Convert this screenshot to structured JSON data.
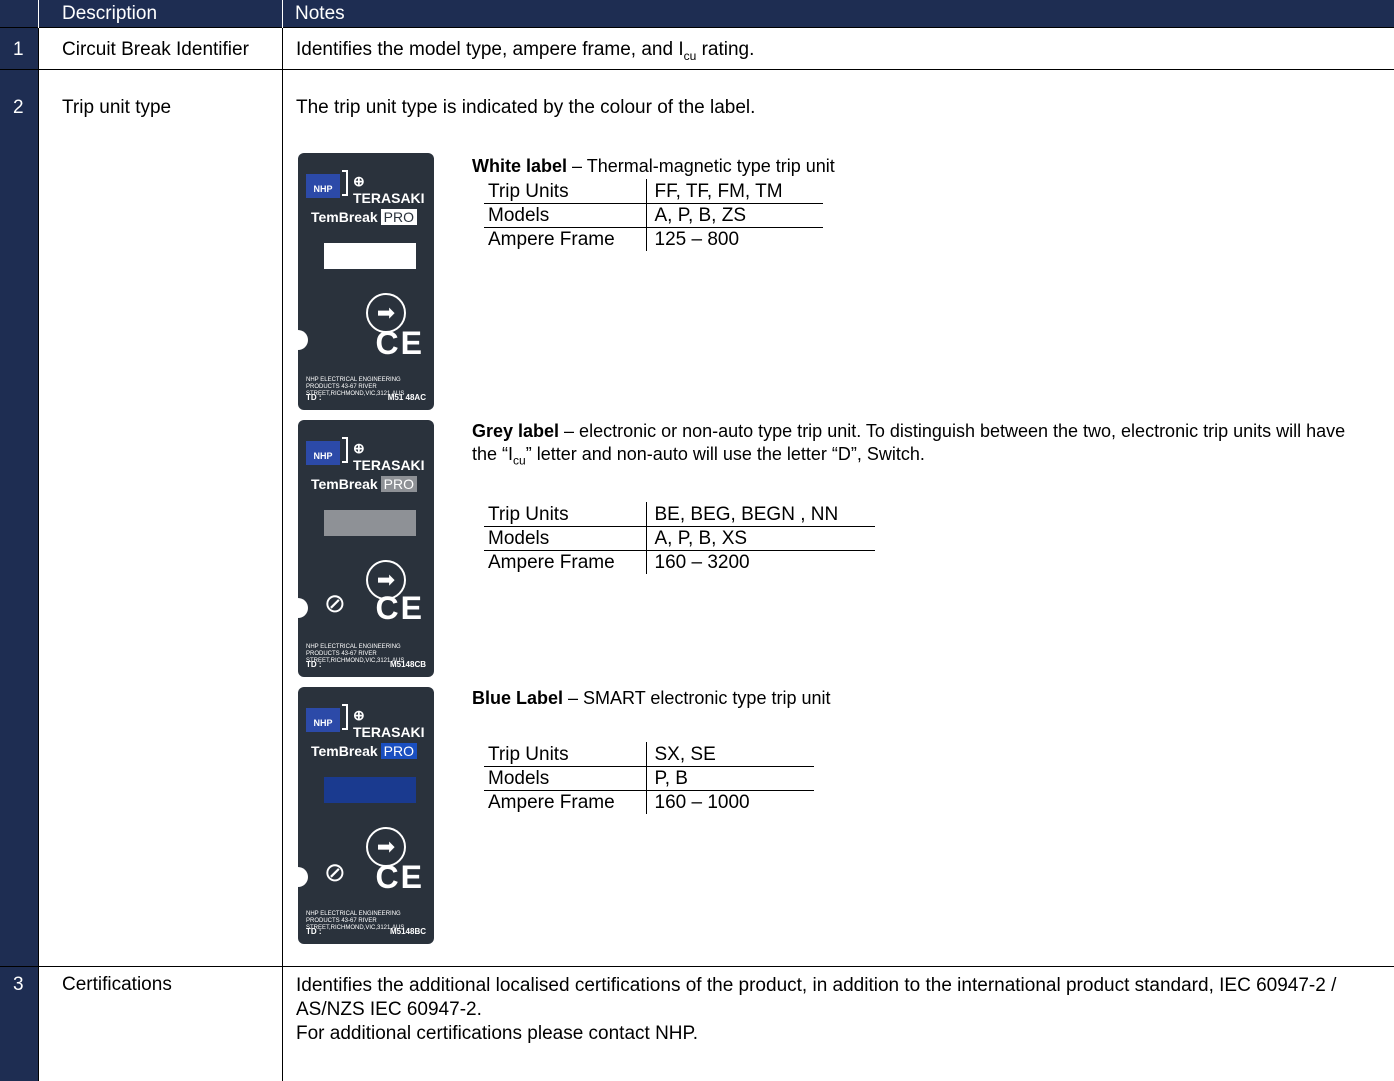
{
  "header": {
    "col_description": "Description",
    "col_notes": "Notes"
  },
  "rows": [
    {
      "number": "1",
      "description": "Circuit Break Identifier",
      "notes_prefix": "Identifies the model type, ampere frame, and I",
      "notes_sub": "cu",
      "notes_suffix": " rating."
    },
    {
      "number": "2",
      "description": "Trip unit type",
      "notes": "The trip unit type is indicated by the colour of the label.",
      "labels": [
        {
          "title": "White label",
          "text": " – Thermal-magnetic type trip unit",
          "swatch_color": "#ffffff",
          "pro_color": "#ffffff",
          "has_rcm": false,
          "td_code": "M51 48AC",
          "table": {
            "keys": [
              "Trip Units",
              "Models",
              "Ampere Frame"
            ],
            "values": [
              "FF, TF, FM, TM",
              "A, P, B, ZS",
              "125 – 800"
            ]
          }
        },
        {
          "title": "Grey label",
          "text_a": " – electronic or non-auto type trip unit. To distinguish between the two, electronic trip units will have the “I",
          "text_sub": "cu",
          "text_b": "” letter and non-auto will use the letter “D”, Switch.",
          "swatch_color": "#8e9196",
          "pro_color": "#8e9196",
          "has_rcm": true,
          "td_code": "M5148CB",
          "table": {
            "keys": [
              "Trip Units",
              "Models",
              "Ampere Frame"
            ],
            "values": [
              "BE, BEG, BEGN , NN",
              "A, P, B, XS",
              "160 – 3200"
            ]
          }
        },
        {
          "title": "Blue Label",
          "text": " – SMART electronic type trip unit",
          "swatch_color": "#1a3a8f",
          "pro_color": "#1a4fc0",
          "has_rcm": true,
          "td_code": "M5148BC",
          "table": {
            "keys": [
              "Trip Units",
              "Models",
              "Ampere Frame"
            ],
            "values": [
              "SX, SE",
              "P, B",
              "160 – 1000"
            ]
          }
        }
      ]
    },
    {
      "number": "3",
      "description": "Certifications",
      "notes_line1": "Identifies the additional localised certifications of the product, in addition to the international product standard, IEC 60947-2 /",
      "notes_line2": "AS/NZS IEC 60947-2.",
      "notes_line3": "For additional certifications please contact NHP."
    }
  ],
  "label_image": {
    "nhp": "NHP",
    "brand": "⊕ TERASAKI",
    "product": "TemBreak",
    "pro": "PRO",
    "arrow": "➡",
    "ce": "CE",
    "rcm_icon": "RCM",
    "address": "NHP ELECTRICAL ENGINEERING PRODUCTS 43-67 RIVER STREET,RICHMOND,VIC,3121,AUS",
    "td_label": "TD :"
  }
}
